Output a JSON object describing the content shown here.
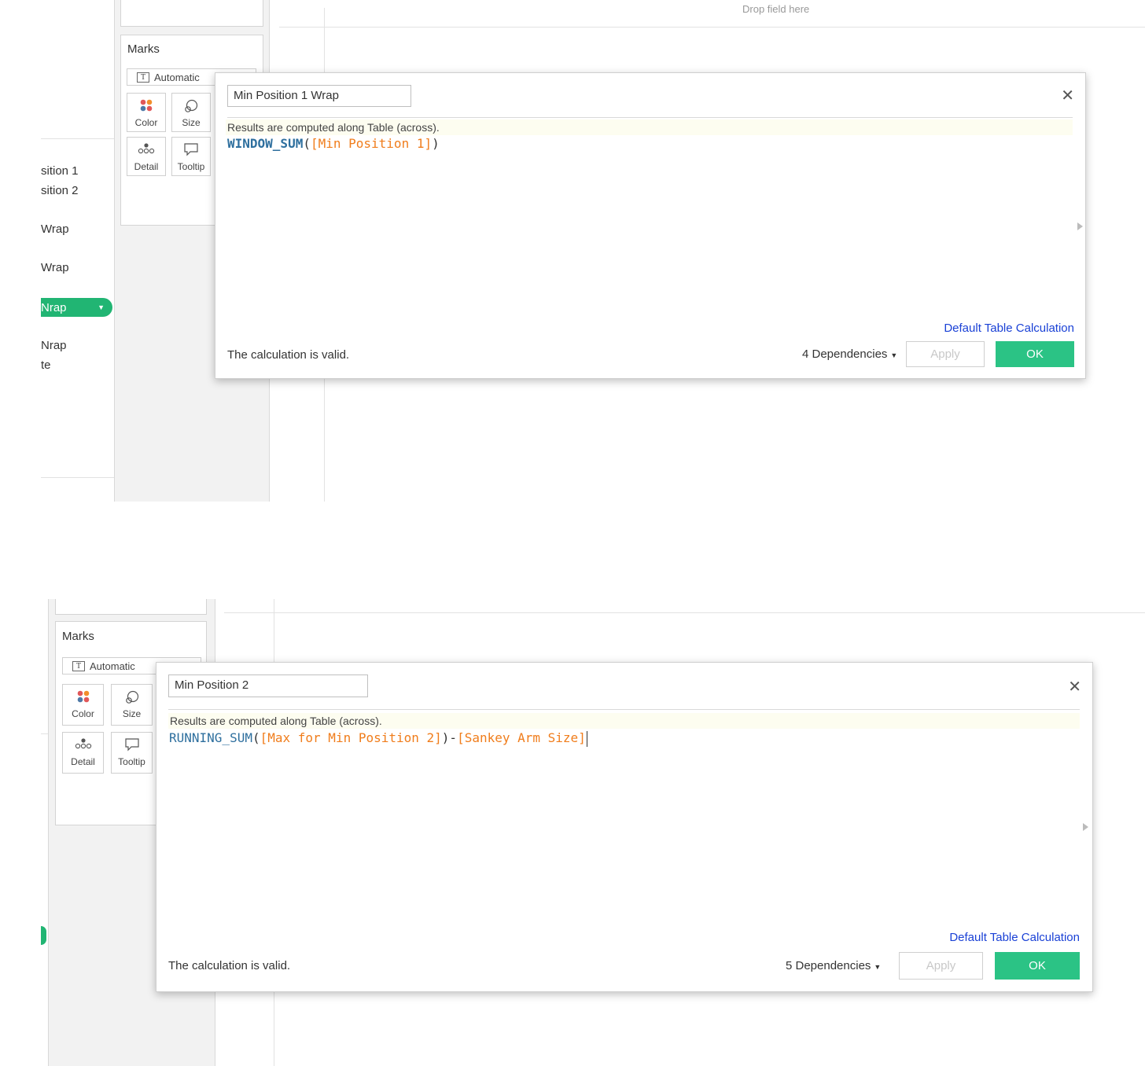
{
  "common": {
    "marks_title": "Marks",
    "mark_type": "Automatic",
    "buttons": {
      "color": "Color",
      "size": "Size",
      "detail": "Detail",
      "tooltip": "Tooltip"
    },
    "hint": "Results are computed along Table (across).",
    "default_table_calc": "Default Table Calculation",
    "status": "The calculation is valid.",
    "apply_label": "Apply",
    "ok_label": "OK"
  },
  "top": {
    "drop_field": "Drop field here",
    "fields": [
      "sition 1",
      "sition 2",
      "Wrap",
      "Wrap",
      "Nrap",
      "Nrap",
      "te"
    ],
    "calc_name": "Min Position 1 Wrap",
    "formula": {
      "fn": "WINDOW_SUM",
      "open": "(",
      "field": "[Min Position 1]",
      "close": ")"
    },
    "dependencies": "4 Dependencies"
  },
  "bottom": {
    "calc_name": "Min Position 2",
    "formula": {
      "fn": "RUNNING_SUM",
      "open": "(",
      "field1": "[Max for Min Position 2]",
      "mid": ")-",
      "field2": "[Sankey Arm Size]"
    },
    "dependencies": "5 Dependencies"
  },
  "colors": {
    "accent_green": "#2bc385",
    "pill_green": "#21b573",
    "link_blue": "#1a41d6",
    "function_blue": "#2e6f9e",
    "field_orange": "#f07d1c"
  }
}
